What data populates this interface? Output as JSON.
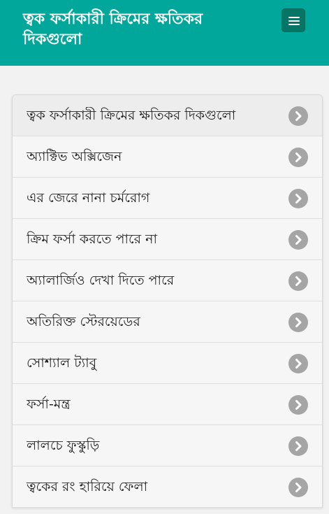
{
  "header": {
    "title": "ত্বক ফর্সাকারী ক্রিমের ক্ষতিকর দিকগুলো",
    "menu_icon": "hamburger-icon",
    "background_color": "#00a79a",
    "menu_button_color": "#077565"
  },
  "list": {
    "item_icon": "chevron-right-icon",
    "items": [
      {
        "label": "ত্বক ফর্সাকারী ক্রিমের ক্ষতিকর দিকগুলো"
      },
      {
        "label": "অ্যাক্টিভ অক্সিজেন"
      },
      {
        "label": "এর জেরে নানা চর্মরোগ"
      },
      {
        "label": "ক্রিম ফর্সা করতে পারে না"
      },
      {
        "label": "অ্যালার্জিও দেখা দিতে পারে"
      },
      {
        "label": "অতিরিক্ত স্টেরয়েডের"
      },
      {
        "label": "সোশ্যাল ট্যাবু"
      },
      {
        "label": "ফর্সা-মন্ত্র"
      },
      {
        "label": "লালচে ফুস্কুড়ি"
      },
      {
        "label": "ত্বকের রং হারিয়ে ফেলা"
      }
    ]
  }
}
